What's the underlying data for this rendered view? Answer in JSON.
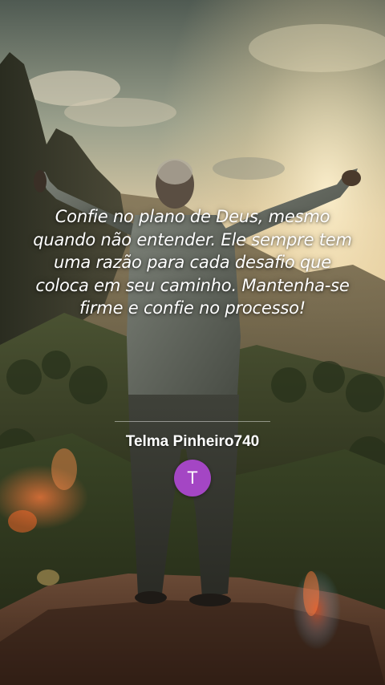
{
  "quote": {
    "text": "Confie no plano de Deus, mesmo quando não entender. Ele sempre tem uma razão para cada desafio que coloca em seu caminho. Mantenha-se firme e confie no processo!"
  },
  "author": {
    "name": "Telma Pinheiro740",
    "avatar_initial": "T",
    "avatar_color": "#a446c4"
  },
  "background": {
    "scene": "man-arms-raised-on-mountain-icon"
  }
}
